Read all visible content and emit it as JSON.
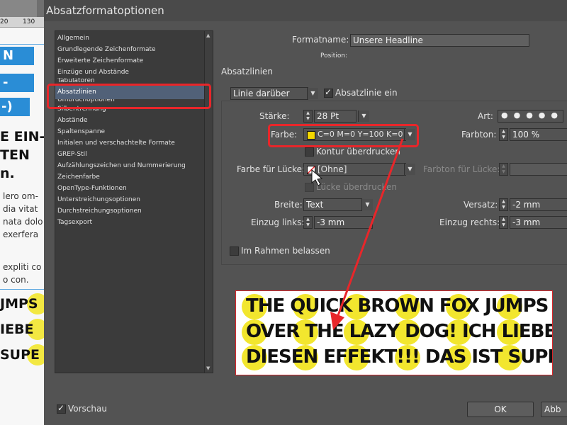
{
  "document": {
    "ruler": [
      "20",
      "130"
    ],
    "headline_boxes": [
      "N",
      "-",
      "-)"
    ],
    "big_lines": [
      "E EIN-",
      "TEN",
      "n."
    ],
    "body_lines": [
      "lero om-",
      "dia vitat",
      "nata dolo",
      "exerfera"
    ],
    "body_lines2": [
      "expliti co",
      "o con."
    ],
    "preview_lines": [
      "JMPS",
      "IEBE",
      "SUPE"
    ]
  },
  "dialog": {
    "title": "Absatzformatoptionen",
    "sidebar": {
      "items": [
        "Allgemein",
        "Grundlegende Zeichenformate",
        "Erweiterte Zeichenformate",
        "Einzüge und Abstände",
        "Tabulatoren",
        "Absatzlinien",
        "Umbruchoptionen",
        "Silbentrennung",
        "Abstände",
        "Spaltenspanne",
        "Initialen und verschachtelte Formate",
        "GREP-Stil",
        "Aufzählungszeichen und Nummerierung",
        "Zeichenfarbe",
        "OpenType-Funktionen",
        "Unterstreichungsoptionen",
        "Durchstreichungsoptionen",
        "Tagsexport"
      ],
      "selected_index": 5
    },
    "format_name_label": "Formatname:",
    "format_name_value": "Unsere Headline",
    "position_label": "Position:",
    "section_title": "Absatzlinien",
    "rule_select": "Linie darüber",
    "rule_on_label": "Absatzlinie ein",
    "weight_label": "Stärke:",
    "weight_value": "28 Pt",
    "type_label": "Art:",
    "color_label": "Farbe:",
    "color_value": "C=0 M=0 Y=100 K=0",
    "color_swatch": "#f5d800",
    "tint_label": "Farbton:",
    "tint_value": "100 %",
    "overprint_stroke_label": "Kontur überdrucken",
    "gap_color_label": "Farbe für Lücke:",
    "gap_color_value": "[Ohne]",
    "gap_tint_label": "Farbton für Lücke:",
    "overprint_gap_label": "Lücke überdrucken",
    "width_label": "Breite:",
    "width_value": "Text",
    "offset_label": "Versatz:",
    "offset_value": "-2 mm",
    "indent_left_label": "Einzug links:",
    "indent_left_value": "-3 mm",
    "indent_right_label": "Einzug rechts:",
    "indent_right_value": "-3 mm",
    "keep_in_frame_label": "Im Rahmen belassen",
    "preview_label": "Vorschau",
    "ok_label": "OK",
    "cancel_label": "Abb",
    "preview_lines": [
      "THE QUICK BROWN FOX JUMPS",
      "OVER THE LAZY DOG! ICH LIEBE",
      "DIESEN EFFEKT!!! DAS IST SUPE"
    ],
    "highlight_color": "#e8262a"
  }
}
